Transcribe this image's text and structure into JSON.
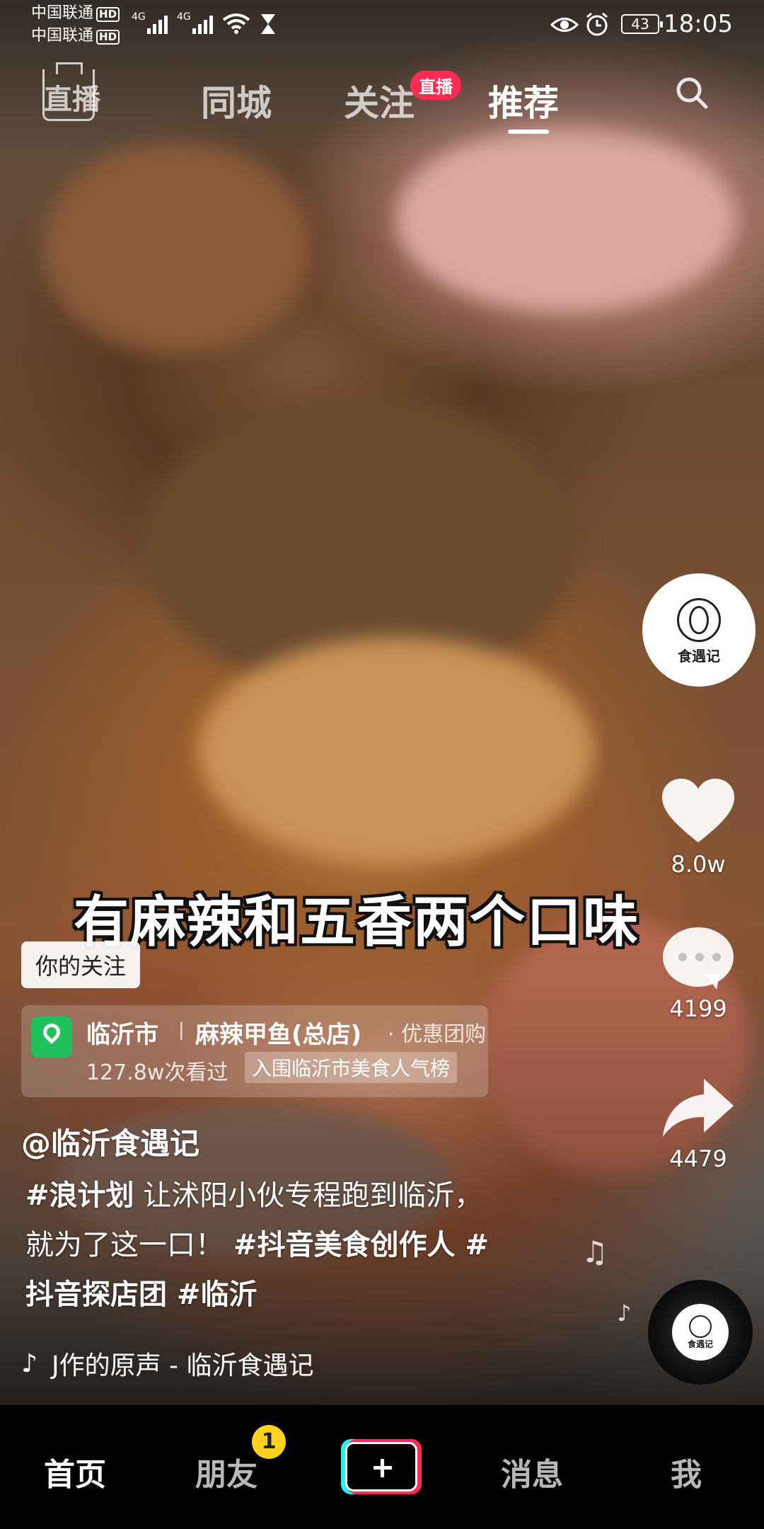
{
  "status_bar": {
    "carrier1": "中国联通",
    "carrier2": "中国联通",
    "hd": "HD",
    "network": "4G",
    "battery": "43",
    "time": "18:05"
  },
  "top_nav": {
    "live": "直播",
    "city": "同城",
    "follow": "关注",
    "follow_badge": "直播",
    "recommend": "推荐"
  },
  "video": {
    "caption": "有麻辣和五香两个口味"
  },
  "right_rail": {
    "avatar_text": "食遇记",
    "likes": "8.0w",
    "comments": "4199",
    "shares": "4479"
  },
  "info": {
    "follow_tag": "你的关注",
    "poi_city": "临沂市",
    "poi_separator": "|",
    "poi_shop": "麻辣甲鱼(总店)",
    "poi_deal": "· 优惠团购",
    "poi_views": "127.8w次看过",
    "poi_rank": "入围临沂市美食人气榜",
    "author": "@临沂食遇记",
    "desc_tag1": "#浪计划",
    "desc_text1": " 让沭阳小伙专程跑到临沂，",
    "desc_text2": "就为了这一口！",
    "desc_tag2": " #抖音美食创作人 #",
    "desc_tag3": "抖音探店团 #临沂",
    "music": "J作的原声 - 临沂食遇记"
  },
  "tab_bar": {
    "home": "首页",
    "friends": "朋友",
    "friends_badge": "1",
    "messages": "消息",
    "me": "我"
  },
  "colors": {
    "accent": "#fe2c55",
    "cyan": "#25f4ee",
    "poi_green": "#20c05c",
    "badge_yellow": "#ffd21f"
  }
}
